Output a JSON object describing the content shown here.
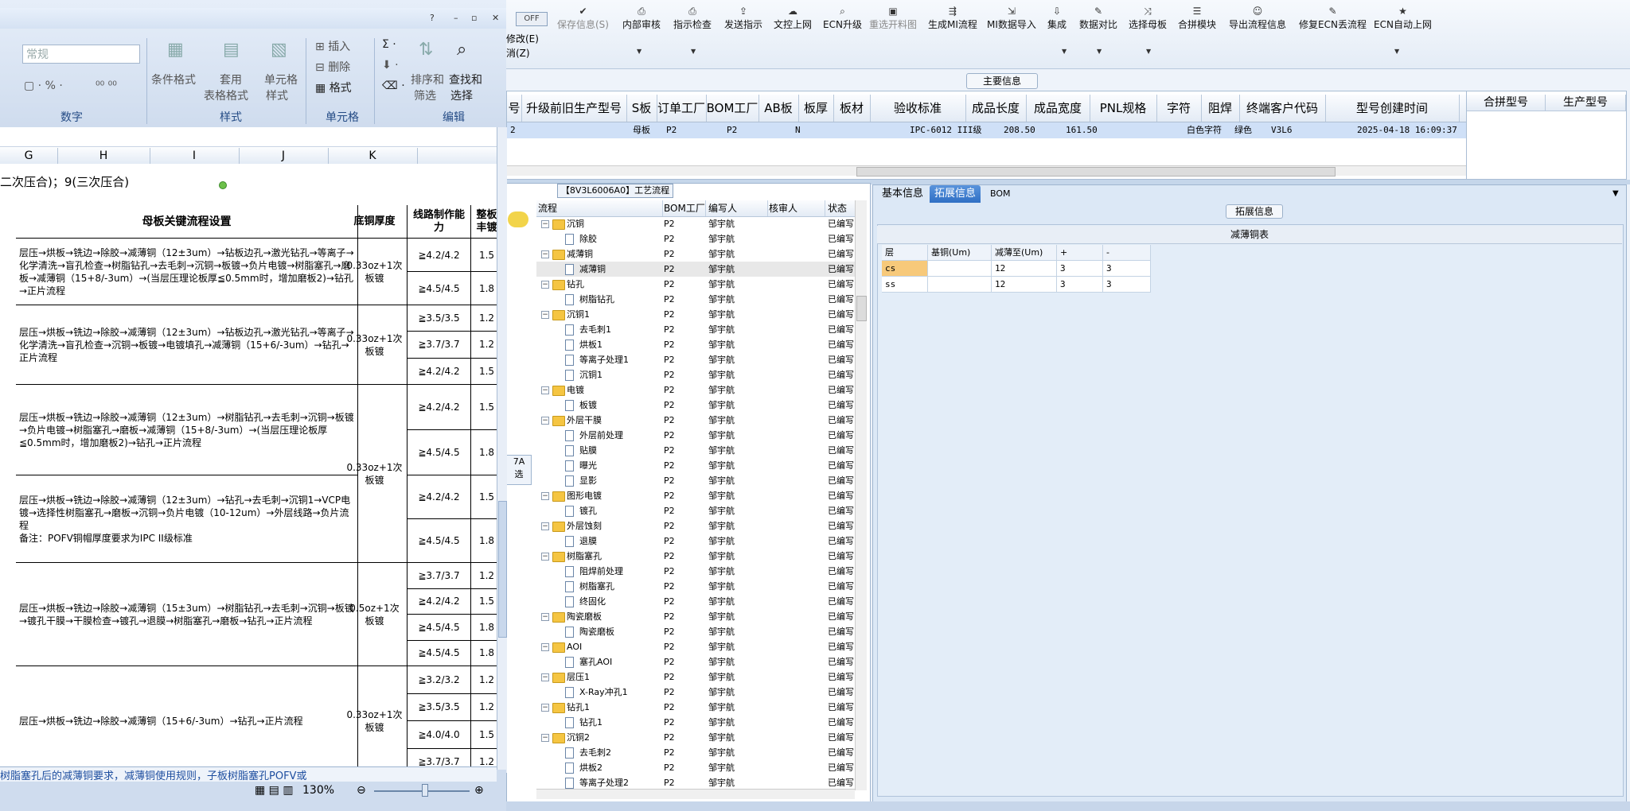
{
  "toolbar": {
    "off_label": "OFF",
    "side_labels": [
      "修改(E)",
      "消(Z)"
    ],
    "buttons": [
      {
        "label": "保存信息(S)",
        "icon": "check-icon",
        "disabled": true
      },
      {
        "label": "内部审核",
        "icon": "print-icon"
      },
      {
        "label": "指示检查",
        "icon": "print-icon"
      },
      {
        "label": "发送指示",
        "icon": "upload-icon"
      },
      {
        "label": "文控上网",
        "icon": "cloud-icon"
      },
      {
        "label": "ECN升级",
        "icon": "binoculars-icon"
      },
      {
        "label": "重选开料图",
        "icon": "image-icon",
        "disabled": true
      },
      {
        "label": "生成MI流程",
        "icon": "flow-icon"
      },
      {
        "label": "MI数据导入",
        "icon": "import-icon"
      },
      {
        "label": "集成",
        "icon": "download-icon"
      },
      {
        "label": "数据对比",
        "icon": "wrench-icon"
      },
      {
        "label": "选择母板",
        "icon": "shuffle-icon"
      },
      {
        "label": "合拼模块",
        "icon": "list-icon"
      },
      {
        "label": "导出流程信息",
        "icon": "smile-icon"
      },
      {
        "label": "修复ECN丢流程",
        "icon": "wrench-icon"
      },
      {
        "label": "ECN自动上网",
        "icon": "star-icon"
      }
    ]
  },
  "main_info": {
    "title": "主要信息",
    "headers": [
      "号",
      "升级前旧生产型号",
      "S板",
      "订单工厂",
      "BOM工厂",
      "AB板",
      "板厚",
      "板材",
      "验收标准",
      "成品长度",
      "成品宽度",
      "PNL规格",
      "字符",
      "阻焊",
      "终端客户代码",
      "型号创建时间"
    ],
    "row": {
      "c0": "2",
      "s_board": "母板",
      "order_factory": "P2",
      "bom_factory": "P2",
      "ab": "N",
      "standard": "IPC-6012 III级",
      "length": "208.50",
      "width": "161.50",
      "char": "白色字符",
      "mask": "绿色",
      "customer": "V3L6",
      "created": "2025-04-18 16:09:37"
    },
    "side_headers": [
      "合拼型号",
      "生产型号"
    ]
  },
  "process": {
    "title": "【8V3L6006A0】工艺流程",
    "headers": [
      "流程",
      "BOM工厂",
      "编写人",
      "核审人",
      "状态"
    ],
    "rows": [
      {
        "level": 1,
        "name": "沉铜",
        "type": "folder",
        "bom": "P2",
        "writer": "邹宇航",
        "status": "已编写"
      },
      {
        "level": 2,
        "name": "除胶",
        "type": "doc",
        "bom": "P2",
        "writer": "邹宇航",
        "status": "已编写"
      },
      {
        "level": 1,
        "name": "减薄铜",
        "type": "folder",
        "bom": "P2",
        "writer": "邹宇航",
        "status": "已编写"
      },
      {
        "level": 2,
        "name": "减薄铜",
        "type": "doc",
        "bom": "P2",
        "writer": "邹宇航",
        "status": "已编写"
      },
      {
        "level": 1,
        "name": "钻孔",
        "type": "folder",
        "bom": "P2",
        "writer": "邹宇航",
        "status": "已编写"
      },
      {
        "level": 2,
        "name": "树脂钻孔",
        "type": "doc",
        "bom": "P2",
        "writer": "邹宇航",
        "status": "已编写"
      },
      {
        "level": 1,
        "name": "沉铜1",
        "type": "folder",
        "bom": "P2",
        "writer": "邹宇航",
        "status": "已编写"
      },
      {
        "level": 2,
        "name": "去毛刺1",
        "type": "doc",
        "bom": "P2",
        "writer": "邹宇航",
        "status": "已编写"
      },
      {
        "level": 2,
        "name": "烘板1",
        "type": "doc",
        "bom": "P2",
        "writer": "邹宇航",
        "status": "已编写"
      },
      {
        "level": 2,
        "name": "等离子处理1",
        "type": "doc",
        "bom": "P2",
        "writer": "邹宇航",
        "status": "已编写"
      },
      {
        "level": 2,
        "name": "沉铜1",
        "type": "doc",
        "bom": "P2",
        "writer": "邹宇航",
        "status": "已编写"
      },
      {
        "level": 1,
        "name": "电镀",
        "type": "folder",
        "bom": "P2",
        "writer": "邹宇航",
        "status": "已编写"
      },
      {
        "level": 2,
        "name": "板镀",
        "type": "doc",
        "bom": "P2",
        "writer": "邹宇航",
        "status": "已编写"
      },
      {
        "level": 1,
        "name": "外层干膜",
        "type": "folder",
        "bom": "P2",
        "writer": "邹宇航",
        "status": "已编写"
      },
      {
        "level": 2,
        "name": "外层前处理",
        "type": "doc",
        "bom": "P2",
        "writer": "邹宇航",
        "status": "已编写"
      },
      {
        "level": 2,
        "name": "贴膜",
        "type": "doc",
        "bom": "P2",
        "writer": "邹宇航",
        "status": "已编写"
      },
      {
        "level": 2,
        "name": "曝光",
        "type": "doc",
        "bom": "P2",
        "writer": "邹宇航",
        "status": "已编写"
      },
      {
        "level": 2,
        "name": "显影",
        "type": "doc",
        "bom": "P2",
        "writer": "邹宇航",
        "status": "已编写"
      },
      {
        "level": 1,
        "name": "图形电镀",
        "type": "folder",
        "bom": "P2",
        "writer": "邹宇航",
        "status": "已编写"
      },
      {
        "level": 2,
        "name": "镀孔",
        "type": "doc",
        "bom": "P2",
        "writer": "邹宇航",
        "status": "已编写"
      },
      {
        "level": 1,
        "name": "外层蚀刻",
        "type": "folder",
        "bom": "P2",
        "writer": "邹宇航",
        "status": "已编写"
      },
      {
        "level": 2,
        "name": "退膜",
        "type": "doc",
        "bom": "P2",
        "writer": "邹宇航",
        "status": "已编写"
      },
      {
        "level": 1,
        "name": "树脂塞孔",
        "type": "folder",
        "bom": "P2",
        "writer": "邹宇航",
        "status": "已编写"
      },
      {
        "level": 2,
        "name": "阻焊前处理",
        "type": "doc",
        "bom": "P2",
        "writer": "邹宇航",
        "status": "已编写"
      },
      {
        "level": 2,
        "name": "树脂塞孔",
        "type": "doc",
        "bom": "P2",
        "writer": "邹宇航",
        "status": "已编写"
      },
      {
        "level": 2,
        "name": "终固化",
        "type": "doc",
        "bom": "P2",
        "writer": "邹宇航",
        "status": "已编写"
      },
      {
        "level": 1,
        "name": "陶瓷磨板",
        "type": "folder",
        "bom": "P2",
        "writer": "邹宇航",
        "status": "已编写"
      },
      {
        "level": 2,
        "name": "陶瓷磨板",
        "type": "doc",
        "bom": "P2",
        "writer": "邹宇航",
        "status": "已编写"
      },
      {
        "level": 1,
        "name": "AOI",
        "type": "folder",
        "bom": "P2",
        "writer": "邹宇航",
        "status": "已编写"
      },
      {
        "level": 2,
        "name": "塞孔AOI",
        "type": "doc",
        "bom": "P2",
        "writer": "邹宇航",
        "status": "已编写"
      },
      {
        "level": 1,
        "name": "层压1",
        "type": "folder",
        "bom": "P2",
        "writer": "邹宇航",
        "status": "已编写"
      },
      {
        "level": 2,
        "name": "X-Ray冲孔1",
        "type": "doc",
        "bom": "P2",
        "writer": "邹宇航",
        "status": "已编写"
      },
      {
        "level": 1,
        "name": "钻孔1",
        "type": "folder",
        "bom": "P2",
        "writer": "邹宇航",
        "status": "已编写"
      },
      {
        "level": 2,
        "name": "钻孔1",
        "type": "doc",
        "bom": "P2",
        "writer": "邹宇航",
        "status": "已编写"
      },
      {
        "level": 1,
        "name": "沉铜2",
        "type": "folder",
        "bom": "P2",
        "writer": "邹宇航",
        "status": "已编写"
      },
      {
        "level": 2,
        "name": "去毛刺2",
        "type": "doc",
        "bom": "P2",
        "writer": "邹宇航",
        "status": "已编写"
      },
      {
        "level": 2,
        "name": "烘板2",
        "type": "doc",
        "bom": "P2",
        "writer": "邹宇航",
        "status": "已编写"
      },
      {
        "level": 2,
        "name": "等离子处理2",
        "type": "doc",
        "bom": "P2",
        "writer": "邹宇航",
        "status": "已编写"
      }
    ]
  },
  "detail": {
    "tabs": [
      "基本信息",
      "拓展信息",
      "BOM"
    ],
    "active_tab": "拓展信息",
    "section_title": "拓展信息",
    "table_title": "减薄铜表",
    "headers": [
      "层",
      "基铜(Um)",
      "减薄至(Um)",
      "+",
      "-"
    ],
    "rows": [
      {
        "layer": "cs",
        "base": "",
        "to": "12",
        "plus": "3",
        "minus": "3"
      },
      {
        "layer": "ss",
        "base": "",
        "to": "12",
        "plus": "3",
        "minus": "3"
      }
    ]
  },
  "excel": {
    "format_box": "常规",
    "groups": [
      "数字",
      "样式",
      "单元格",
      "编辑"
    ],
    "buttons": {
      "cond_format": "条件格式",
      "table_format_1": "套用",
      "table_format_2": "表格格式",
      "cell_style_1": "单元格",
      "cell_style_2": "样式",
      "insert": "插入",
      "delete": "删除",
      "format": "格式",
      "sort_1": "排序和",
      "sort_2": "筛选",
      "find_1": "查找和",
      "find_2": "选择"
    },
    "columns": [
      "G",
      "H",
      "I",
      "J",
      "K"
    ],
    "top_note": "二次压合)；9(三次压合)",
    "header_h": "母板关键流程设置",
    "header_k": "底铜厚度",
    "header_l": "线路制作能力",
    "header_m": "整板丰镀",
    "blocks": [
      {
        "flow": "层压→烘板→铣边→除胶→减薄铜（12±3um）→钻板边孔→激光钻孔→等离子→化学清洗→盲孔检查→树脂钻孔→去毛刺→沉铜→板镀→负片电镀→树脂塞孔→磨板→减薄铜（15+8/-3um）→(当层压理论板厚≦0.5mm时，增加磨板2)→钻孔→正片流程",
        "cu": "0.33oz+1次板镀",
        "abilities": [
          "≧4.2/4.2",
          "≧4.5/4.5"
        ],
        "m": [
          "1.5",
          "1.8"
        ]
      },
      {
        "flow": "层压→烘板→铣边→除胶→减薄铜（12±3um）→钻板边孔→激光钻孔→等离子→化学清洗→盲孔检查→沉铜→板镀→电镀填孔→减薄铜（15+6/-3um）→钻孔→正片流程",
        "cu": "0.33oz+1次板镀",
        "abilities": [
          "≧3.5/3.5",
          "≧3.7/3.7",
          "≧4.2/4.2"
        ],
        "m": [
          "1.2",
          "1.2",
          "1.5"
        ]
      },
      {
        "flow": "层压→烘板→铣边→除胶→减薄铜（12±3um）→树脂钻孔→去毛刺→沉铜→板镀→负片电镀→树脂塞孔→磨板→减薄铜（15+8/-3um）→(当层压理论板厚≦0.5mm时，增加磨板2)→钻孔→正片流程",
        "abilities": [
          "≧4.2/4.2",
          "≧4.5/4.5"
        ],
        "m": [
          "1.5",
          "1.8"
        ]
      },
      {
        "flow": "层压→烘板→铣边→除胶→减薄铜（12±3um）→钻孔→去毛刺→沉铜1→VCP电镀→选择性树脂塞孔→磨板→沉铜→负片电镀（10-12um）→外层线路→负片流程\n备注：POFV铜帽厚度要求为IPC II级标准",
        "cu_shared": "0.33oz+1次板镀",
        "abilities": [
          "≧4.2/4.2",
          "≧4.5/4.5"
        ],
        "m": [
          "1.5",
          "1.8"
        ]
      },
      {
        "flow": "层压→烘板→铣边→除胶→减薄铜（15±3um）→树脂钻孔→去毛刺→沉铜→板镀→镀孔干膜→干膜检查→镀孔→退膜→树脂塞孔→磨板→钻孔→正片流程",
        "cu": "0.5oz+1次板镀",
        "abilities": [
          "≧3.7/3.7",
          "≧4.2/4.2",
          "≧4.5/4.5",
          "≧4.5/4.5"
        ],
        "m": [
          "1.2",
          "1.5",
          "1.8",
          "1.8"
        ]
      },
      {
        "flow": "层压→烘板→铣边→除胶→减薄铜（15+6/-3um）→钻孔→正片流程",
        "cu": "0.33oz+1次板镀",
        "abilities": [
          "≧3.2/3.2",
          "≧3.5/3.5",
          "≧4.0/4.0",
          "≧3.7/3.7"
        ],
        "m": [
          "1.2",
          "1.2",
          "1.5",
          "1.2"
        ]
      }
    ],
    "sheet_tab_text": "树脂塞孔后的减薄铜要求，减薄铜使用规则，子板树脂塞孔POFV或",
    "zoom": "130%",
    "side_text": [
      "7A",
      "选"
    ]
  }
}
